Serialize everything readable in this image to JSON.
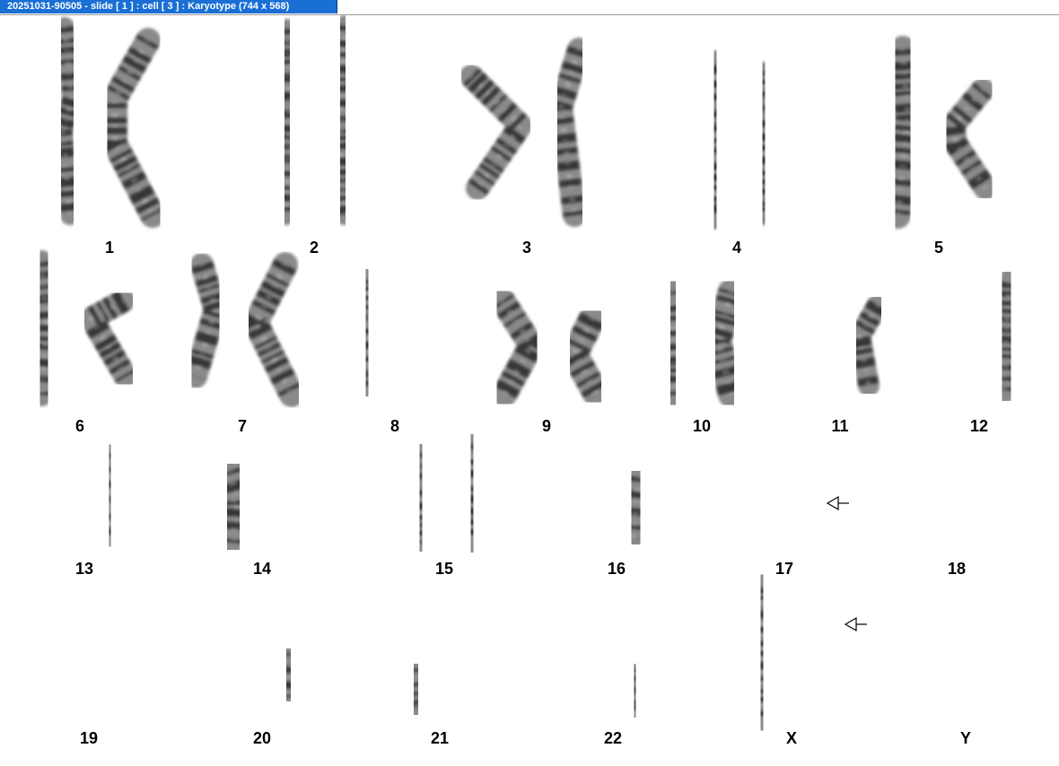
{
  "window": {
    "title": "20251031-90505 - slide [ 1 ] : cell [ 3 ] : Karyotype  (744 x 568)"
  },
  "colors": {
    "title_bg": "#1a6fd4",
    "title_text": "#ffffff",
    "band": "#1e1e1e"
  },
  "karyotype": {
    "groups": [
      {
        "label": "1",
        "marked": false
      },
      {
        "label": "2",
        "marked": false
      },
      {
        "label": "3",
        "marked": false
      },
      {
        "label": "4",
        "marked": false
      },
      {
        "label": "5",
        "marked": false
      },
      {
        "label": "6",
        "marked": false
      },
      {
        "label": "7",
        "marked": false
      },
      {
        "label": "8",
        "marked": false
      },
      {
        "label": "9",
        "marked": false
      },
      {
        "label": "10",
        "marked": false
      },
      {
        "label": "11",
        "marked": false
      },
      {
        "label": "12",
        "marked": false
      },
      {
        "label": "13",
        "marked": false
      },
      {
        "label": "14",
        "marked": false
      },
      {
        "label": "15",
        "marked": false
      },
      {
        "label": "16",
        "marked": false
      },
      {
        "label": "17",
        "marked": true
      },
      {
        "label": "18",
        "marked": false
      },
      {
        "label": "19",
        "marked": false
      },
      {
        "label": "20",
        "marked": false
      },
      {
        "label": "21",
        "marked": false
      },
      {
        "label": "22",
        "marked": false
      },
      {
        "label": "X",
        "marked": true
      },
      {
        "label": "Y",
        "marked": false
      }
    ]
  }
}
